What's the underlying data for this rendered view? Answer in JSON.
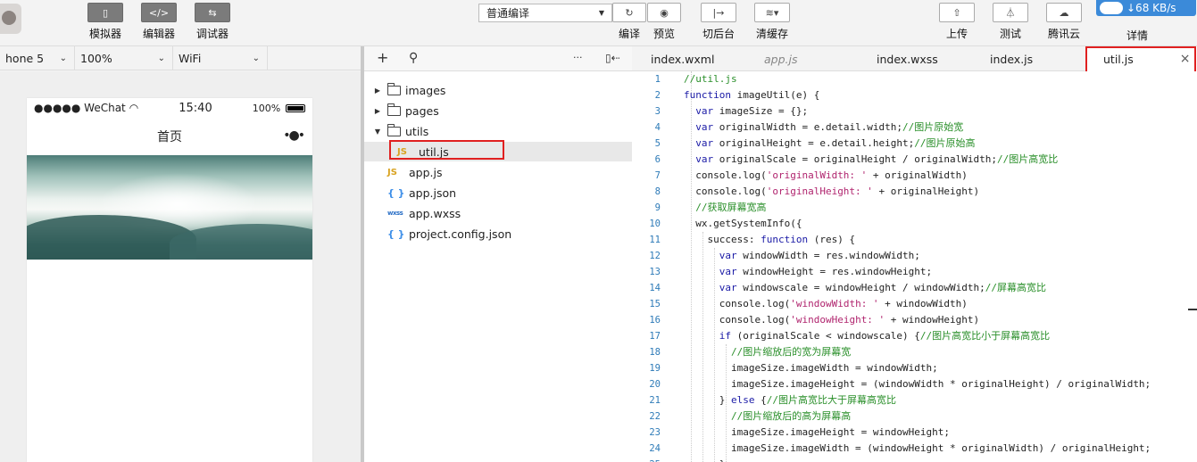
{
  "toolbar": {
    "simulator": {
      "label": "模拟器",
      "icon": "phone-icon"
    },
    "editor": {
      "label": "编辑器",
      "icon": "code-icon",
      "glyph": "</>"
    },
    "debugger": {
      "label": "调试器",
      "icon": "debug-icon",
      "glyph": "⇆"
    },
    "compile_mode": "普通编译",
    "compile": {
      "label": "编译",
      "icon": "refresh-icon"
    },
    "preview": {
      "label": "预览",
      "icon": "eye-icon"
    },
    "background": {
      "label": "切后台",
      "icon": "switch-background-icon"
    },
    "clear_cache": {
      "label": "清缓存",
      "icon": "layers-icon"
    },
    "upload": {
      "label": "上传",
      "icon": "upload-icon"
    },
    "test": {
      "label": "测试",
      "icon": "flask-icon"
    },
    "tencent_cloud": {
      "label": "腾讯云",
      "icon": "cloud-icon"
    },
    "details": {
      "label": "详情",
      "icon": "details-icon"
    },
    "net_speed": "↓68 KB/s"
  },
  "device_bar": {
    "device": "hone 5",
    "zoom": "100%",
    "network": "WiFi"
  },
  "phone": {
    "carrier": "●●●●● WeChat",
    "time": "15:40",
    "battery": "100%",
    "nav_title": "首页",
    "more": "•●•"
  },
  "file_tree": {
    "items": [
      {
        "name": "images",
        "type": "folder"
      },
      {
        "name": "pages",
        "type": "folder"
      },
      {
        "name": "utils",
        "type": "folder",
        "expanded": true
      },
      {
        "name": "util.js",
        "type": "js",
        "selected": true
      },
      {
        "name": "app.js",
        "type": "js"
      },
      {
        "name": "app.json",
        "type": "json"
      },
      {
        "name": "app.wxss",
        "type": "wxss"
      },
      {
        "name": "project.config.json",
        "type": "json"
      }
    ],
    "icons": {
      "js": "JS",
      "json": "{ }",
      "wxss": "wxss"
    }
  },
  "editor_tabs": [
    {
      "label": "index.wxml"
    },
    {
      "label": "app.js",
      "preview": true
    },
    {
      "label": "index.wxss"
    },
    {
      "label": "index.js"
    },
    {
      "label": "util.js",
      "active": true,
      "close": "×"
    }
  ],
  "code_lines": [
    "//util.js",
    "function imageUtil(e) {",
    "  var imageSize = {};",
    "  var originalWidth = e.detail.width;//图片原始宽",
    "  var originalHeight = e.detail.height;//图片原始高",
    "  var originalScale = originalHeight / originalWidth;//图片高宽比",
    "  console.log('originalWidth: ' + originalWidth)",
    "  console.log('originalHeight: ' + originalHeight)",
    "  //获取屏幕宽高",
    "  wx.getSystemInfo({",
    "    success: function (res) {",
    "      var windowWidth = res.windowWidth;",
    "      var windowHeight = res.windowHeight;",
    "      var windowscale = windowHeight / windowWidth;//屏幕高宽比",
    "      console.log('windowWidth: ' + windowWidth)",
    "      console.log('windowHeight: ' + windowHeight)",
    "      if (originalScale < windowscale) {//图片高宽比小于屏幕高宽比",
    "        //图片缩放后的宽为屏幕宽",
    "        imageSize.imageWidth = windowWidth;",
    "        imageSize.imageHeight = (windowWidth * originalHeight) / originalWidth;",
    "      } else {//图片高宽比大于屏幕高宽比",
    "        //图片缩放后的高为屏幕高",
    "        imageSize.imageHeight = windowHeight;",
    "        imageSize.imageWidth = (windowHeight * originalWidth) / originalHeight;",
    "      }"
  ],
  "colors": {
    "accent": "#3b8ad9",
    "highlight": "#e02020",
    "keyword": "#1a1aa6",
    "comment": "#2a8f2a",
    "string": "#b0246e",
    "line_number": "#2e7bb8"
  }
}
